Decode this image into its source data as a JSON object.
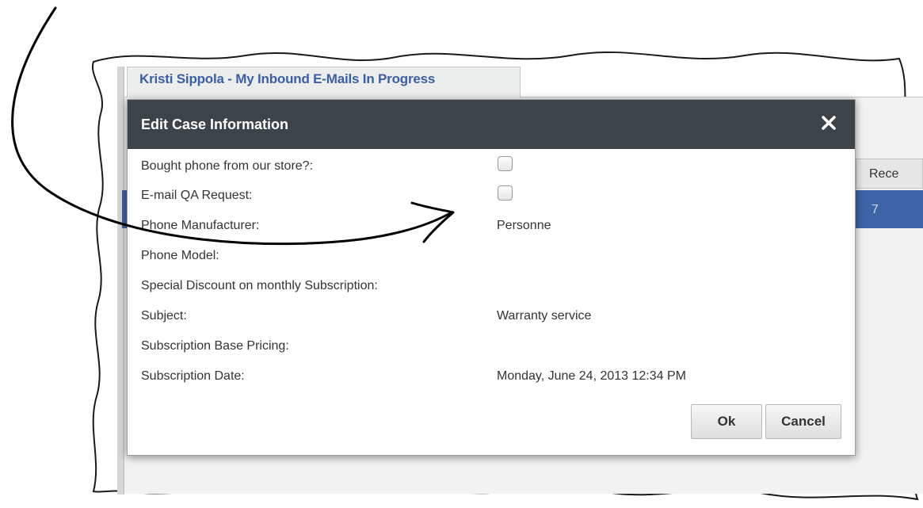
{
  "background": {
    "tab_title": "Kristi Sippola - My Inbound E-Mails In Progress",
    "column_header": "Rece",
    "selected_row_text": "7"
  },
  "dialog": {
    "title": "Edit Case Information",
    "close_icon": "close-icon",
    "fields": [
      {
        "label": "Bought phone from our store?:",
        "type": "checkbox",
        "checked": false
      },
      {
        "label": "E-mail QA Request:",
        "type": "checkbox",
        "checked": false
      },
      {
        "label": "Phone Manufacturer:",
        "value": "Personne"
      },
      {
        "label": "Phone Model:",
        "value": ""
      },
      {
        "label": "Special Discount on monthly Subscription:",
        "value": ""
      },
      {
        "label": "Subject:",
        "value": "Warranty service"
      },
      {
        "label": "Subscription Base Pricing:",
        "value": ""
      },
      {
        "label": "Subscription Date:",
        "value": "Monday, June 24, 2013 12:34 PM"
      }
    ],
    "ok_label": "Ok",
    "cancel_label": "Cancel"
  },
  "colors": {
    "header_bg": "#3d4449",
    "tab_title": "#3a5fa4",
    "selection": "#3e63a8"
  }
}
